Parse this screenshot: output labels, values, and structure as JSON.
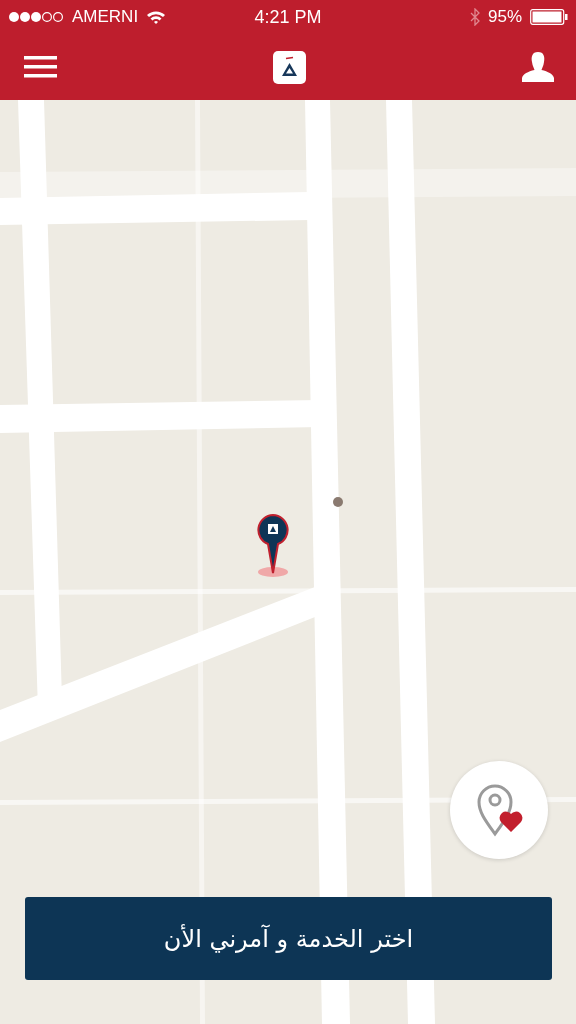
{
  "status_bar": {
    "carrier": "AMERNI",
    "time": "4:21 PM",
    "battery": "95%"
  },
  "action_button": {
    "label": "اختر الخدمة و آمرني الأن"
  }
}
